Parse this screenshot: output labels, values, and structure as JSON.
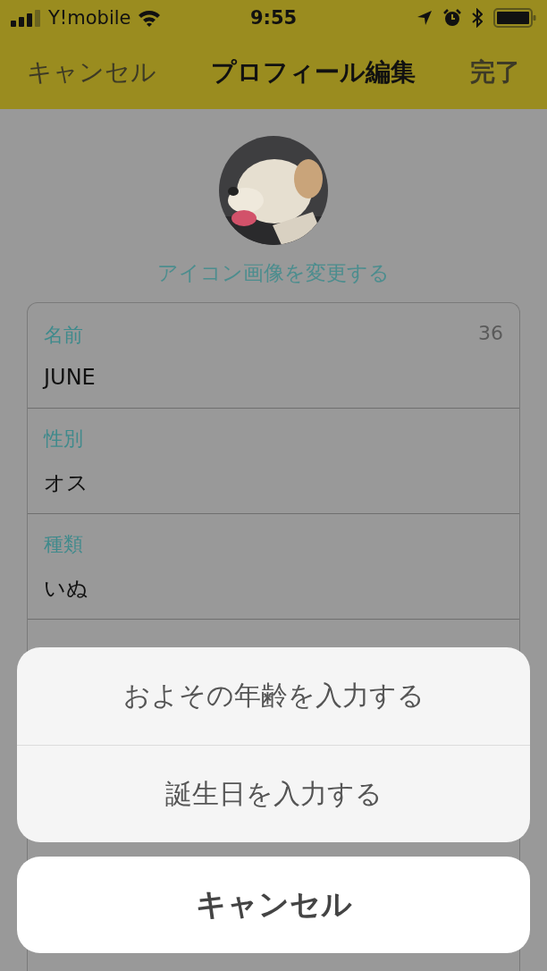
{
  "status_bar": {
    "carrier": "Y!mobile",
    "time": "9:55"
  },
  "nav": {
    "cancel": "キャンセル",
    "title": "プロフィール編集",
    "done": "完了"
  },
  "change_icon_link": "アイコン画像を変更する",
  "fields": [
    {
      "label": "名前",
      "value": "JUNE",
      "count": "36"
    },
    {
      "label": "性別",
      "value": "オス"
    },
    {
      "label": "種類",
      "value": "いぬ"
    }
  ],
  "action_sheet": {
    "options": [
      "およその年齢を入力する",
      "誕生日を入力する"
    ],
    "cancel": "キャンセル"
  }
}
